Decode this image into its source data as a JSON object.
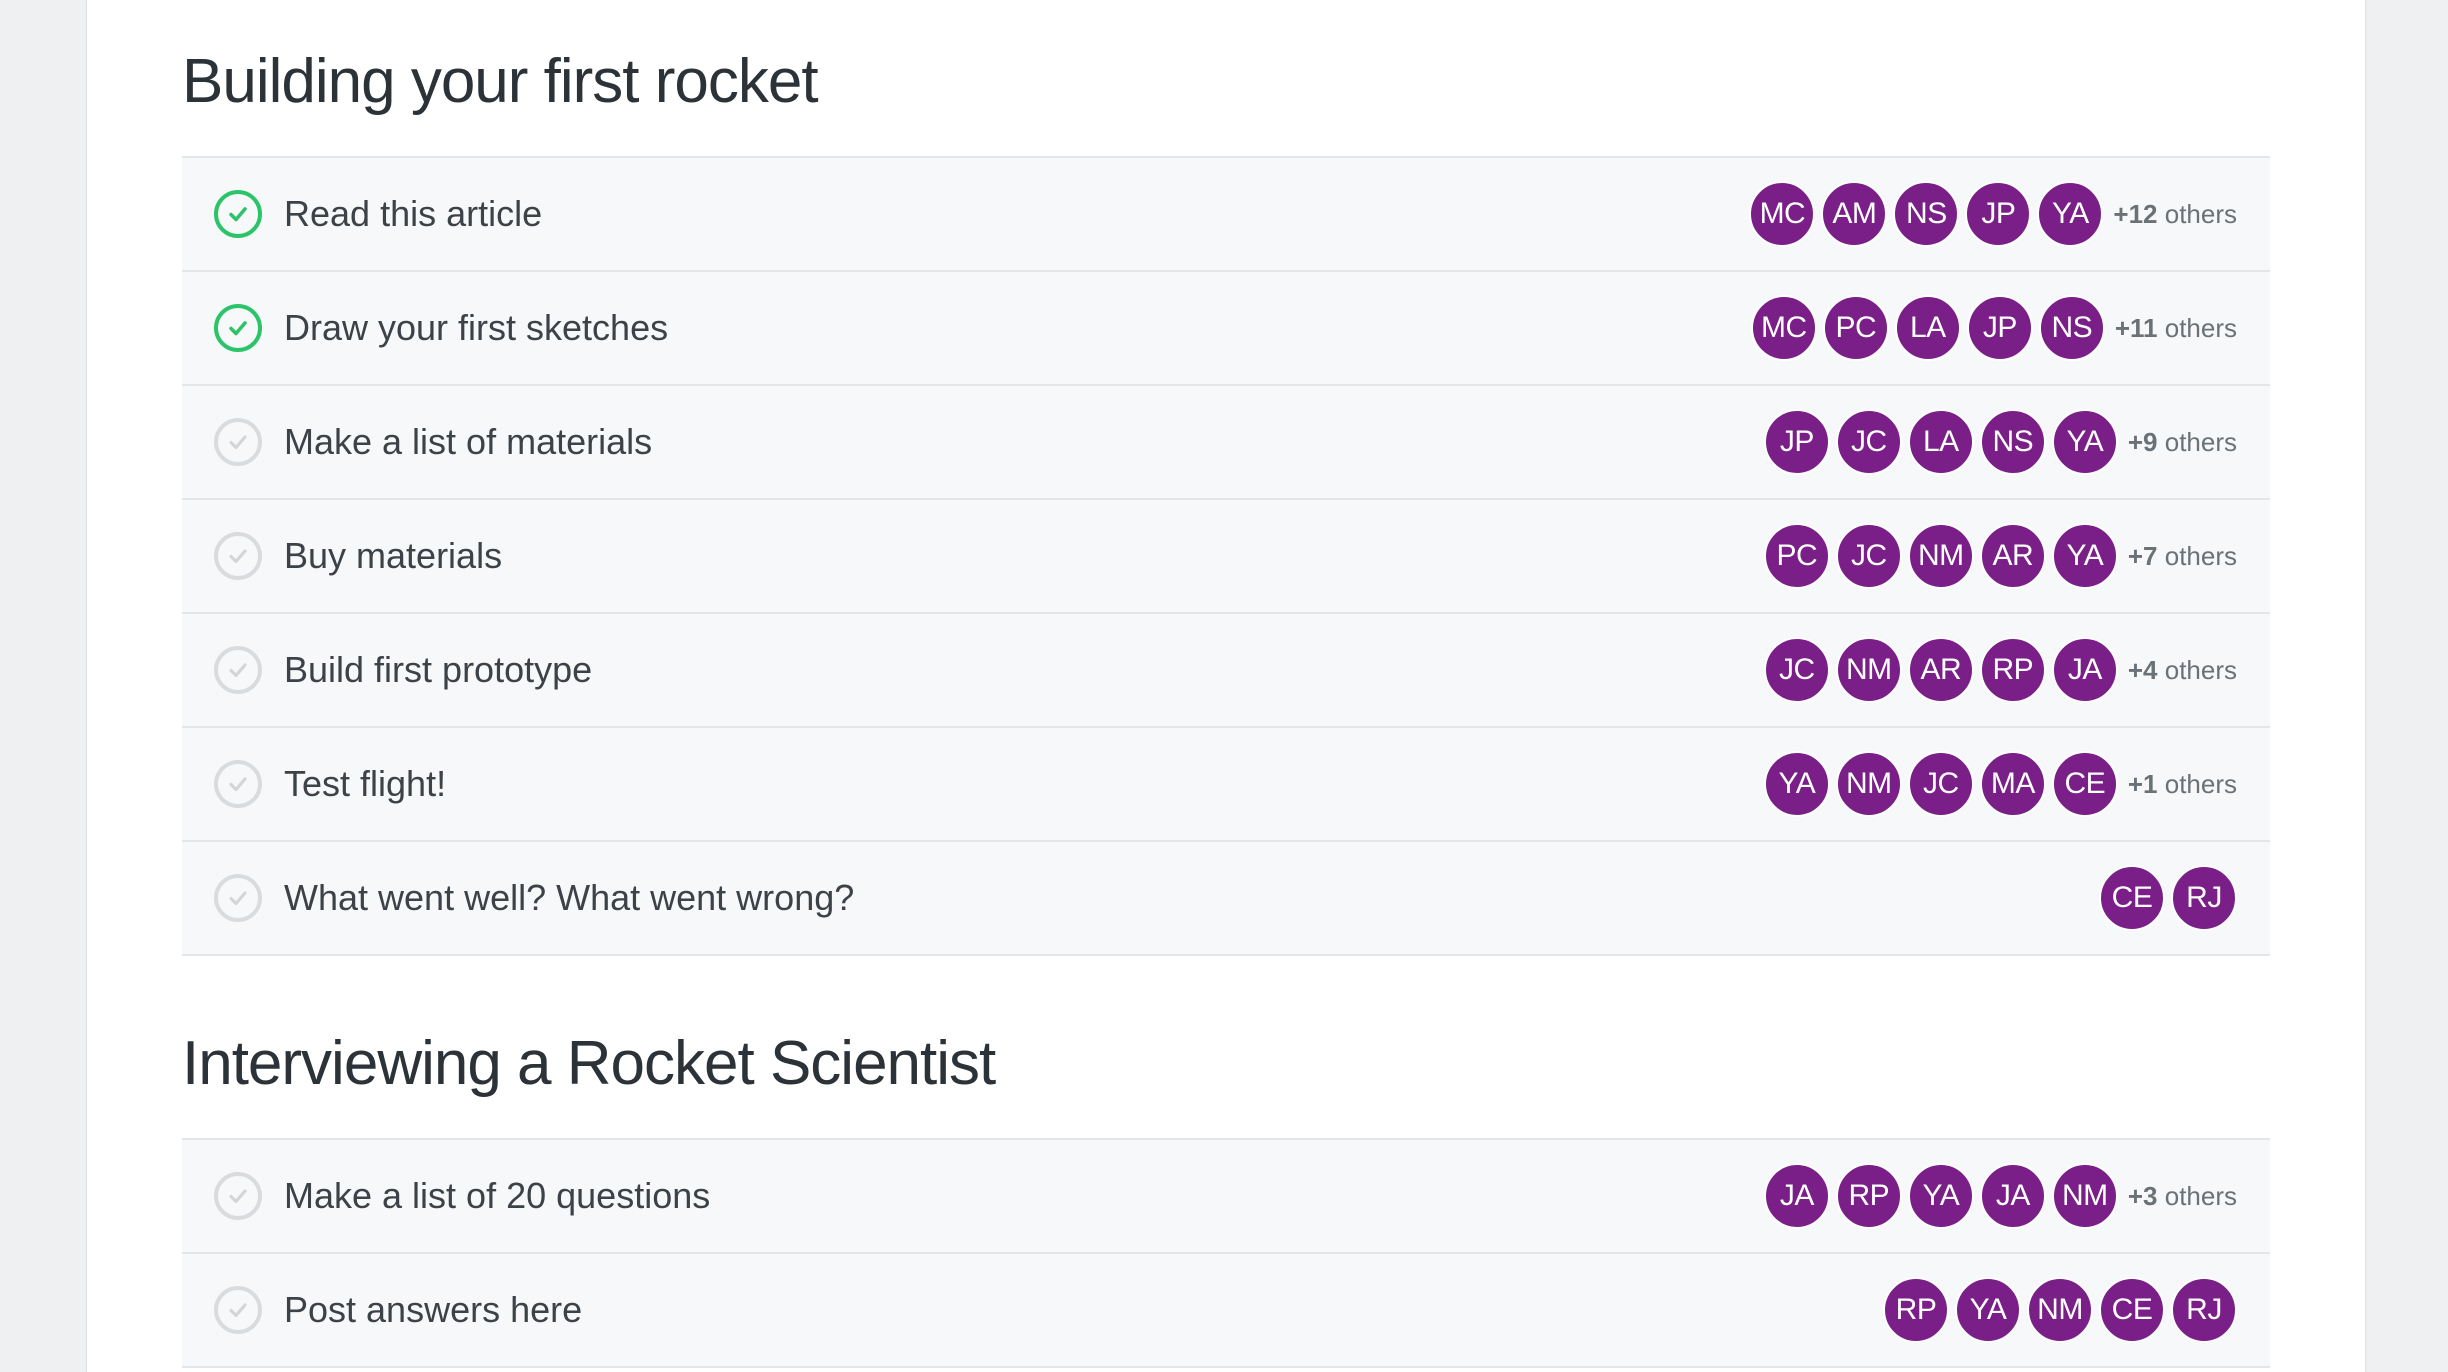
{
  "sections": [
    {
      "title": "Building your first rocket",
      "tasks": [
        {
          "label": "Read this article",
          "done": true,
          "avatars": [
            "MC",
            "AM",
            "NS",
            "JP",
            "YA"
          ],
          "others_count": "+12",
          "others_text": "others"
        },
        {
          "label": "Draw your first sketches",
          "done": true,
          "avatars": [
            "MC",
            "PC",
            "LA",
            "JP",
            "NS"
          ],
          "others_count": "+11",
          "others_text": "others"
        },
        {
          "label": "Make a list of materials",
          "done": false,
          "avatars": [
            "JP",
            "JC",
            "LA",
            "NS",
            "YA"
          ],
          "others_count": "+9",
          "others_text": "others"
        },
        {
          "label": "Buy materials",
          "done": false,
          "avatars": [
            "PC",
            "JC",
            "NM",
            "AR",
            "YA"
          ],
          "others_count": "+7",
          "others_text": "others"
        },
        {
          "label": "Build first prototype",
          "done": false,
          "avatars": [
            "JC",
            "NM",
            "AR",
            "RP",
            "JA"
          ],
          "others_count": "+4",
          "others_text": "others"
        },
        {
          "label": "Test flight!",
          "done": false,
          "avatars": [
            "YA",
            "NM",
            "JC",
            "MA",
            "CE"
          ],
          "others_count": "+1",
          "others_text": "others"
        },
        {
          "label": "What went well? What went wrong?",
          "done": false,
          "avatars": [
            "CE",
            "RJ"
          ],
          "others_count": "",
          "others_text": ""
        }
      ]
    },
    {
      "title": "Interviewing a Rocket Scientist",
      "tasks": [
        {
          "label": "Make a list of 20 questions",
          "done": false,
          "avatars": [
            "JA",
            "RP",
            "YA",
            "JA",
            "NM"
          ],
          "others_count": "+3",
          "others_text": "others"
        },
        {
          "label": "Post answers here",
          "done": false,
          "avatars": [
            "RP",
            "YA",
            "NM",
            "CE",
            "RJ"
          ],
          "others_count": "",
          "others_text": ""
        }
      ]
    }
  ],
  "colors": {
    "avatar_bg": "#7a1f88",
    "check_done": "#2bc46b",
    "check_todo": "#d9dcde"
  },
  "icons": {
    "done": "check-circle-icon",
    "todo": "empty-check-circle-icon"
  }
}
